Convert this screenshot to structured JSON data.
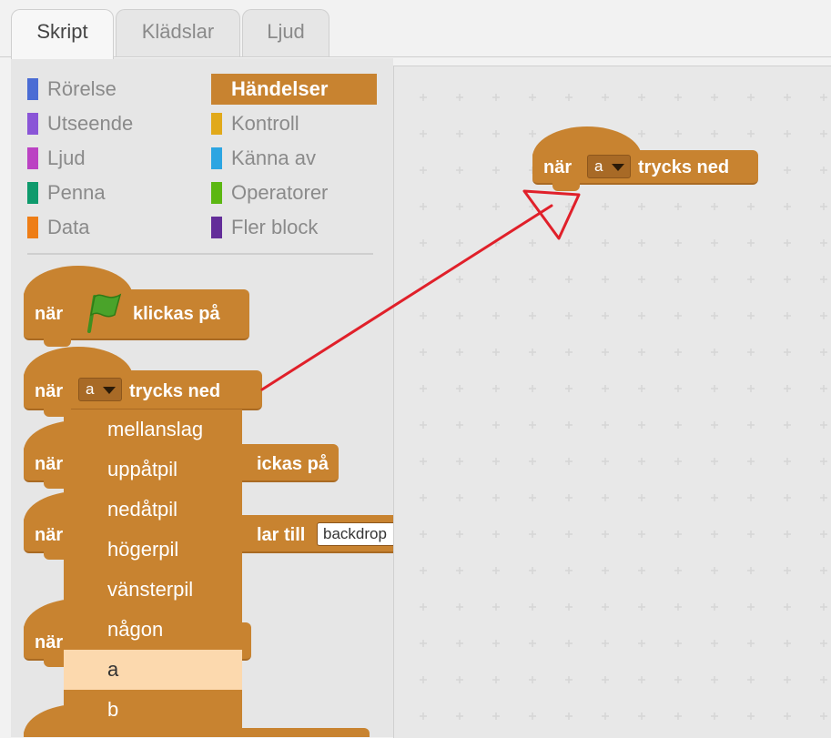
{
  "tabs": [
    {
      "label": "Skript",
      "active": true
    },
    {
      "label": "Klädslar",
      "active": false
    },
    {
      "label": "Ljud",
      "active": false
    }
  ],
  "categories": [
    {
      "label": "Rörelse",
      "color": "#4a6cd4",
      "selected": false
    },
    {
      "label": "Utseende",
      "color": "#8a55d7",
      "selected": false
    },
    {
      "label": "Ljud",
      "color": "#bb42c3",
      "selected": false
    },
    {
      "label": "Penna",
      "color": "#0e9a6c",
      "selected": false
    },
    {
      "label": "Data",
      "color": "#ee7d16",
      "selected": false
    },
    {
      "label": "Händelser",
      "color": "#c88330",
      "selected": true
    },
    {
      "label": "Kontroll",
      "color": "#e1a91a",
      "selected": false
    },
    {
      "label": "Känna av",
      "color": "#2ca5e2",
      "selected": false
    },
    {
      "label": "Operatorer",
      "color": "#5cb712",
      "selected": false
    },
    {
      "label": "Fler block",
      "color": "#632d99",
      "selected": false
    }
  ],
  "palette_blocks": {
    "flag_block": {
      "prefix": "när",
      "suffix": "klickas på",
      "icon": "green-flag-icon"
    },
    "key_block": {
      "prefix": "när",
      "key": "a",
      "suffix": "trycks ned"
    },
    "sprite_click_block": {
      "prefix": "när",
      "suffix": "ickas på"
    },
    "backdrop_block": {
      "prefix": "när",
      "suffix": "lar till",
      "value": "backdrop"
    },
    "block5": {
      "prefix": "när"
    }
  },
  "dropdown": {
    "items": [
      "mellanslag",
      "uppåtpil",
      "nedåtpil",
      "högerpil",
      "vänsterpil",
      "någon",
      "a",
      "b"
    ],
    "selected": "a"
  },
  "script_block": {
    "prefix": "när",
    "key": "a",
    "suffix": "trycks ned"
  },
  "annotation": {
    "type": "red-arrow",
    "color": "#e0202a"
  }
}
